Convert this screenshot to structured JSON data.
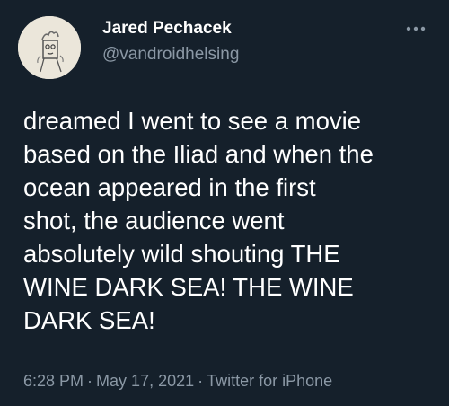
{
  "author": {
    "display_name": "Jared Pechacek",
    "handle": "@vandroidhelsing",
    "avatar_icon": "sketch-avatar-icon"
  },
  "menu": {
    "icon": "more-dots-icon"
  },
  "tweet": {
    "lines": [
      "dreamed I went to see a movie",
      "based on the Iliad and when the",
      "ocean appeared in the first",
      "shot, the audience went",
      "absolutely wild shouting THE",
      "WINE DARK SEA! THE WINE",
      "DARK SEA!"
    ]
  },
  "meta": {
    "time": "6:28 PM",
    "date": "May 17, 2021",
    "source": "Twitter for iPhone",
    "separator": "·"
  },
  "colors": {
    "background": "#15202b",
    "primary_text": "#ffffff",
    "secondary_text": "#8b98a5"
  }
}
